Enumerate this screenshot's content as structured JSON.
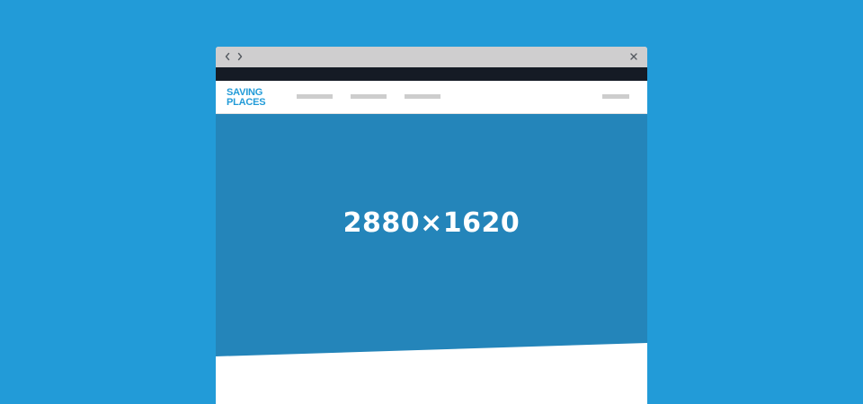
{
  "window": {
    "controls": {
      "back_icon": "chevron-left-icon",
      "forward_icon": "chevron-right-icon",
      "close_icon": "close-icon"
    }
  },
  "header": {
    "logo": {
      "line1": "SAVING",
      "line2": "PLACES"
    }
  },
  "hero": {
    "dimension_label": "2880×1620"
  },
  "colors": {
    "background": "#229bd8",
    "hero": "#2485ba",
    "titlebar": "#cfcecf",
    "darkbar": "#151b25",
    "logo": "#229bd8",
    "nav_placeholder": "#cdcdcd"
  }
}
